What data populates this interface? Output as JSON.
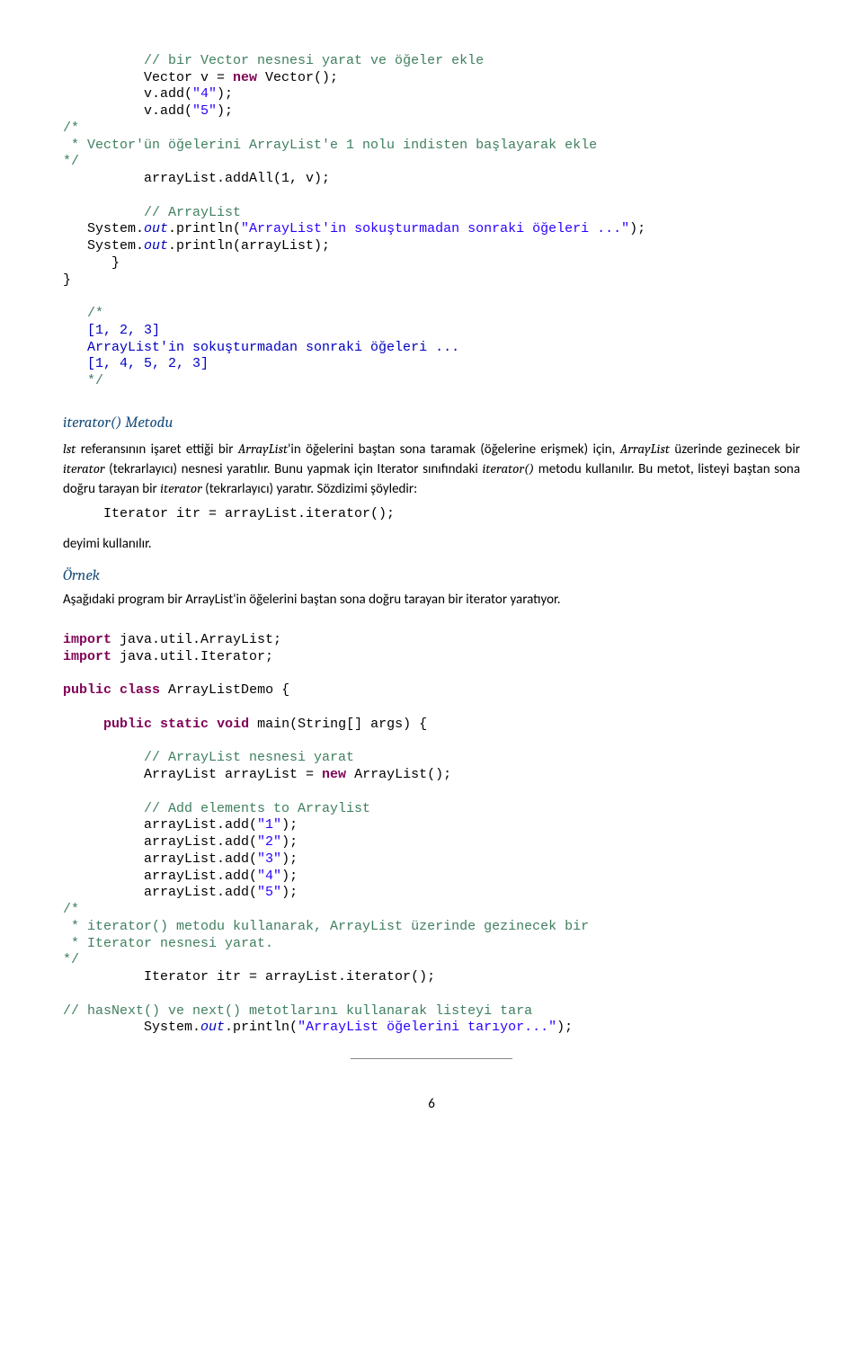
{
  "code1": {
    "c1": "// bir Vector nesnesi yarat ve öğeler ekle",
    "l2a": "          Vector v = ",
    "l2kw": "new",
    "l2b": " Vector();",
    "l3a": "          v.add(",
    "l3s": "\"4\"",
    "l3b": ");",
    "l4a": "          v.add(",
    "l4s": "\"5\"",
    "l4b": ");",
    "c5": "/*",
    "c6": " * Vector'ün öğelerini ArrayList'e 1 nolu indisten başlayarak ekle",
    "c7": "*/",
    "l8": "          arrayList.addAll(1, v);",
    "c9": "          // ArrayList",
    "l10a": "   System.",
    "l10f": "out",
    "l10b": ".println(",
    "l10s": "\"ArrayList'in sokuşturmadan sonraki öğeleri ...\"",
    "l10c": ");",
    "l11a": "   System.",
    "l11f": "out",
    "l11b": ".println(arrayList);",
    "l12": "      }",
    "l13": "}",
    "oc1": "   /*",
    "oc2": "   [1, 2, 3]",
    "oc3": "   ArrayList'in sokuşturmadan sonraki öğeleri ...",
    "oc4": "   [1, 4, 5, 2, 3]",
    "oc5": "   */"
  },
  "sec1_title": "iterator() Metodu",
  "para1_a": "lst",
  "para1_b": "  referansının işaret ettiği bir ",
  "para1_c": "ArrayList",
  "para1_d": "'in öğelerini baştan sona taramak (öğelerine erişmek) için, ",
  "para1_e": "ArrayList",
  "para1_f": " üzerinde gezinecek bir ",
  "para1_g": "iterator",
  "para1_h": " (tekrarlayıcı) nesnesi yaratılır. Bunu yapmak için Iterator sınıfındaki ",
  "para1_i": "iterator()",
  "para1_j": " metodu kullanılır. Bu metot, listeyi baştan sona doğru tarayan bir ",
  "para1_k": "iterator",
  "para1_l": " (tekrarlayıcı) yaratır. Sözdizimi şöyledir:",
  "iter_line": "     Iterator itr = arrayList.iterator();",
  "deyimi": "deyimi kullanılır.",
  "ornek_title": "Örnek",
  "ornek_desc": "Aşağıdaki program bir ArrayList'in öğelerini baştan sona doğru tarayan bir iterator yaratıyor.",
  "code2": {
    "imp1_kw": "import",
    "imp1": " java.util.ArrayList;",
    "imp2_kw": "import",
    "imp2": " java.util.Iterator;",
    "cls_kw1": "public",
    "cls_kw2": "class",
    "cls_rest": " ArrayListDemo {",
    "main_kw1": "public",
    "main_kw2": "static",
    "main_kw3": "void",
    "main_rest": " main(String[] args) {",
    "cA": "          // ArrayList nesnesi yarat",
    "lB_a": "          ArrayList arrayList = ",
    "lB_kw": "new",
    "lB_b": " ArrayList();",
    "cC": "          // Add elements to Arraylist",
    "add1a": "          arrayList.add(",
    "add1s": "\"1\"",
    "add2s": "\"2\"",
    "add3s": "\"3\"",
    "add4s": "\"4\"",
    "add5s": "\"5\"",
    "addb": ");",
    "cD1": "/*",
    "cD2": " * iterator() metodu kullanarak, ArrayList üzerinde gezinecek bir",
    "cD3": " * Iterator nesnesi yarat.",
    "cD4": "*/",
    "iter2": "          Iterator itr = arrayList.iterator();",
    "cE": "// hasNext() ve next() metotlarını kullanarak listeyi tara",
    "prn_a": "          System.",
    "prn_f": "out",
    "prn_b": ".println(",
    "prn_s": "\"ArrayList öğelerini tarıyor...\"",
    "prn_c": ");"
  },
  "page_number": "6"
}
